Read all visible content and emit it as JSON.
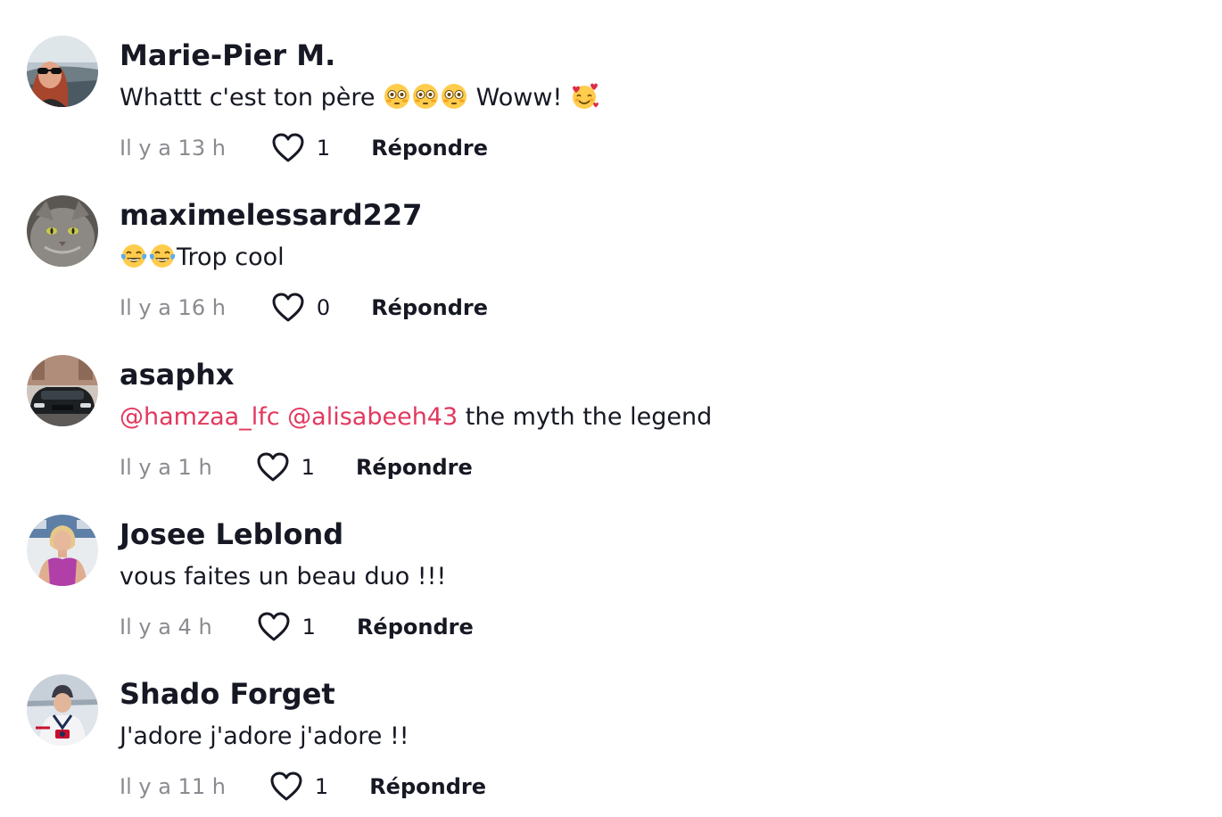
{
  "comments": [
    {
      "username": "Marie-Pier M.",
      "text_parts": [
        "Whattt c'est ton père ",
        " Woww! "
      ],
      "time": "Il y a 13 h",
      "likes": "1",
      "reply_label": "Répondre",
      "avatar": "woman-sunglasses-landscape"
    },
    {
      "username": "maximelessard227",
      "text_parts": [
        "Trop cool"
      ],
      "time": "Il y a 16 h",
      "likes": "0",
      "reply_label": "Répondre",
      "avatar": "grey-cat"
    },
    {
      "username": "asaphx",
      "mentions": [
        "@hamzaa_lfc",
        "@alisabeeh43"
      ],
      "text_parts": [
        " the myth the legend"
      ],
      "time": "Il y a 1 h",
      "likes": "1",
      "reply_label": "Répondre",
      "avatar": "dark-car"
    },
    {
      "username": "Josee Leblond",
      "text_parts": [
        "vous faites un beau duo !!!"
      ],
      "time": "Il y a 4 h",
      "likes": "1",
      "reply_label": "Répondre",
      "avatar": "woman-purple-top"
    },
    {
      "username": "Shado Forget",
      "text_parts": [
        "J'adore j'adore j'adore !!"
      ],
      "time": "Il y a 11 h",
      "likes": "1",
      "reply_label": "Répondre",
      "avatar": "person-hockey-jersey"
    }
  ],
  "colors": {
    "text": "#161823",
    "muted": "#8a8b91",
    "mention": "#e2385e"
  },
  "icons": {
    "like": "heart-outline-icon",
    "flushed": "flushed-face-emoji",
    "hearts": "smiling-face-with-hearts-emoji",
    "laughing": "face-with-tears-of-joy-emoji"
  }
}
